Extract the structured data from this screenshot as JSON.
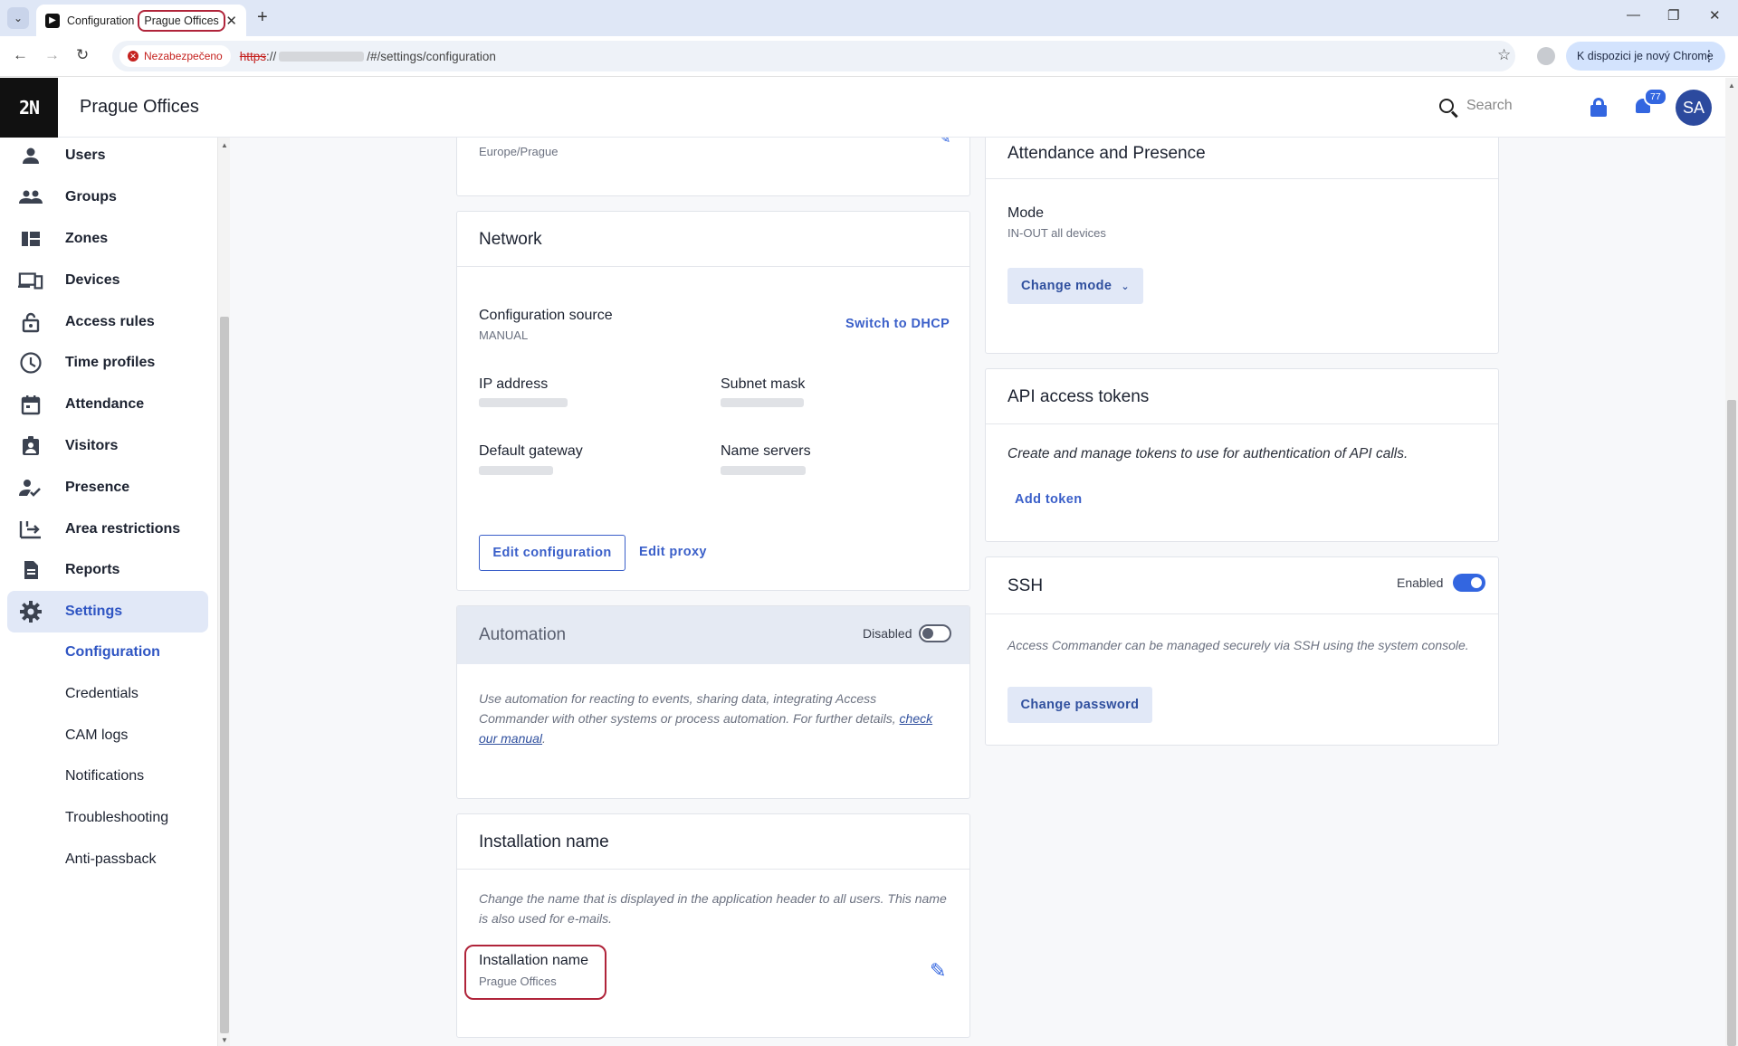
{
  "browser": {
    "tab_title": "Configuration",
    "tab_title_highlight": "Prague Offices",
    "new_tab": "+",
    "insecure_label": "Nezabezpečeno",
    "url_scheme": "https",
    "url_sep": "://",
    "url_path": "/#/settings/configuration",
    "promo": "K dispozici je nový Chrome"
  },
  "header": {
    "logo": "2N",
    "app_name": "Prague Offices",
    "search_placeholder": "Search",
    "notification_count": "77",
    "avatar_initials": "SA"
  },
  "sidebar": {
    "items": [
      {
        "label": "Users",
        "icon": "user-icon"
      },
      {
        "label": "Groups",
        "icon": "groups-icon"
      },
      {
        "label": "Zones",
        "icon": "zones-icon"
      },
      {
        "label": "Devices",
        "icon": "devices-icon"
      },
      {
        "label": "Access rules",
        "icon": "lock-open-icon"
      },
      {
        "label": "Time profiles",
        "icon": "clock-icon"
      },
      {
        "label": "Attendance",
        "icon": "calendar-icon"
      },
      {
        "label": "Visitors",
        "icon": "visitor-badge-icon"
      },
      {
        "label": "Presence",
        "icon": "person-check-icon"
      },
      {
        "label": "Area restrictions",
        "icon": "area-icon"
      },
      {
        "label": "Reports",
        "icon": "report-icon"
      },
      {
        "label": "Settings",
        "icon": "gear-icon"
      }
    ],
    "subitems": [
      "Configuration",
      "Credentials",
      "CAM logs",
      "Notifications",
      "Troubleshooting",
      "Anti-passback"
    ]
  },
  "timezone_card": {
    "value": "Europe/Prague"
  },
  "network": {
    "title": "Network",
    "config_source_label": "Configuration source",
    "config_source_value": "MANUAL",
    "switch_link": "Switch to DHCP",
    "ip_label": "IP address",
    "subnet_label": "Subnet mask",
    "gateway_label": "Default gateway",
    "dns_label": "Name servers",
    "edit_button": "Edit configuration",
    "proxy_link": "Edit proxy"
  },
  "automation": {
    "title": "Automation",
    "toggle_label": "Disabled",
    "text": "Use automation for reacting to events, sharing data, integrating Access Commander with other systems or process automation. For further details,",
    "link": "check our manual",
    "end": "."
  },
  "installation": {
    "title": "Installation name",
    "text": "Change the name that is displayed in the application header to all users. This name is also used for e-mails.",
    "label": "Installation name",
    "value": "Prague Offices"
  },
  "attendance": {
    "title": "Attendance and Presence",
    "mode_label": "Mode",
    "mode_value": "IN-OUT all devices",
    "change_button": "Change mode"
  },
  "api": {
    "title": "API access tokens",
    "text": "Create and manage tokens to use for authentication of API calls.",
    "add_link": "Add token"
  },
  "ssh": {
    "title": "SSH",
    "toggle_label": "Enabled",
    "text": "Access Commander can be managed securely via SSH using the system console.",
    "button": "Change password"
  },
  "colors": {
    "accent": "#3366e0",
    "active_bg": "#e1e8f7",
    "highlight": "#b0243a"
  }
}
